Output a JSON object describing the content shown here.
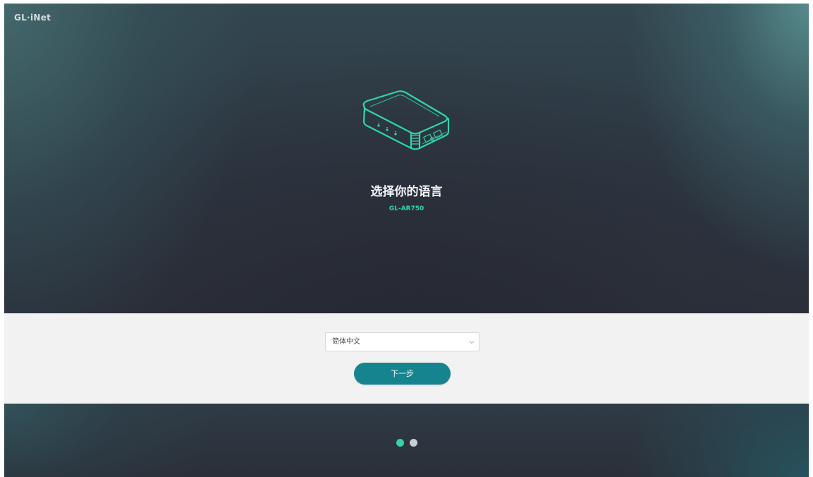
{
  "brand": {
    "logo_text": "GL·iNet"
  },
  "hero": {
    "device_icon": "router-device-icon",
    "title": "选择你的语言",
    "model": "GL-AR750"
  },
  "language_select": {
    "value": "简体中文",
    "icon": "chevron-down-icon"
  },
  "next_button": {
    "label": "下一步"
  },
  "pagination": {
    "total": 2,
    "active_index": 0,
    "active_color": "#2fd6a6",
    "inactive_color": "#c9cfd3"
  },
  "colors": {
    "accent": "#2fd6a6",
    "button": "#16848e"
  }
}
